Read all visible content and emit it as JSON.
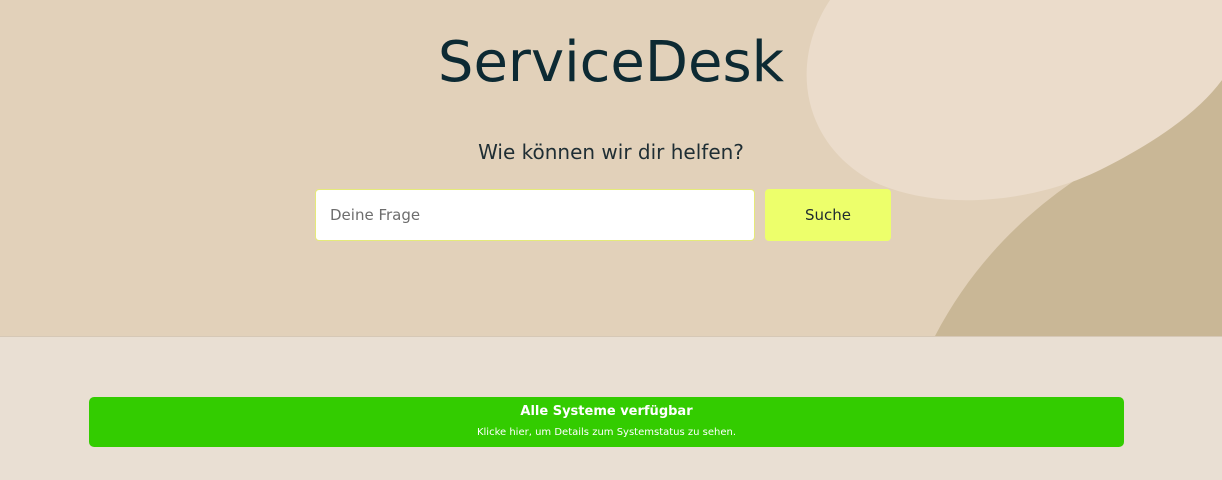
{
  "hero": {
    "title": "ServiceDesk",
    "subtitle": "Wie können wir dir helfen?",
    "colors": {
      "background": "#e2d1ba",
      "light_blob": "#ebdccb",
      "dark_blob": "#c9b796"
    }
  },
  "search": {
    "placeholder": "Deine Frage",
    "value": "",
    "button_label": "Suche",
    "button_color": "#edff6b"
  },
  "status": {
    "title": "Alle Systeme verfügbar",
    "subtitle": "Klicke hier, um Details zum Systemstatus zu sehen.",
    "color": "#33cc00"
  }
}
